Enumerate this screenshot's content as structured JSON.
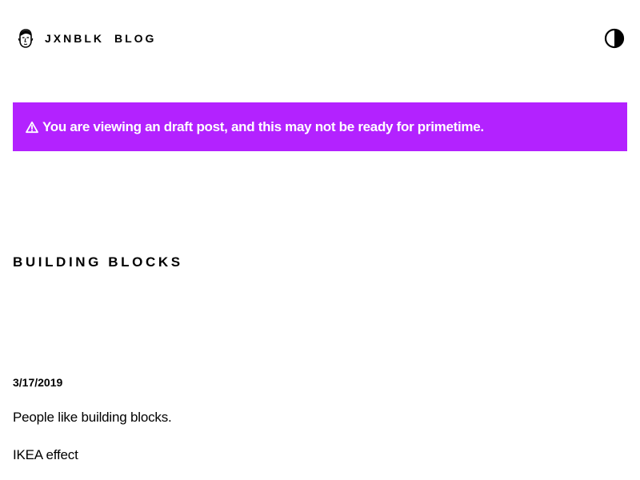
{
  "header": {
    "logo_icon": "avatar-face-icon",
    "nav": {
      "home_label": "JXNBLK",
      "blog_label": "BLOG"
    },
    "theme_toggle_icon": "half-circle-contrast-icon"
  },
  "banner": {
    "icon": "warning-triangle-icon",
    "text": "You are viewing an draft post, and this may not be ready for primetime.",
    "background_color": "#b322ff",
    "text_color": "#ffffff"
  },
  "post": {
    "title": "BUILDING BLOCKS",
    "date": "3/17/2019",
    "paragraphs": [
      "People like building blocks.",
      "IKEA effect"
    ]
  }
}
